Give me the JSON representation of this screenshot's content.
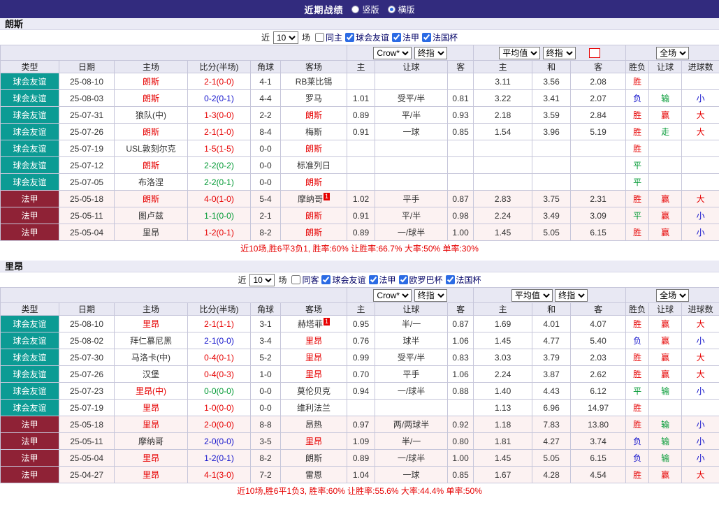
{
  "topbar": {
    "title": "近期战绩",
    "layout_options": [
      {
        "label": "竖版",
        "selected": false
      },
      {
        "label": "横版",
        "selected": true
      }
    ]
  },
  "tables": [
    {
      "team": "朗斯",
      "filter": {
        "prefix": "近",
        "count": "10",
        "suffix": "场",
        "checkboxes": [
          {
            "label": "同主",
            "checked": false
          },
          {
            "label": "球会友谊",
            "checked": true
          },
          {
            "label": "法甲",
            "checked": true
          },
          {
            "label": "法国杯",
            "checked": true
          }
        ]
      },
      "header": {
        "company": "Crow*",
        "company_type": "终指",
        "avg": "平均值",
        "avg_type": "终指",
        "scope": "全场",
        "cols": [
          "类型",
          "日期",
          "主场",
          "比分(半场)",
          "角球",
          "客场",
          "主",
          "让球",
          "客",
          "主",
          "和",
          "客",
          "胜负",
          "让球",
          "进球数"
        ]
      },
      "rows": [
        {
          "type": "球会友谊",
          "league": "friendly",
          "date": "25-08-10",
          "home": "朗斯",
          "home_focal": true,
          "home_badge": "",
          "score": "2-1(0-0)",
          "corner": "4-1",
          "away": "RB莱比锡",
          "away_focal": false,
          "away_badge": "",
          "odds_home": "",
          "handicap": "",
          "odds_away": "",
          "avg_home": "3.11",
          "avg_draw": "3.56",
          "avg_away": "2.08",
          "result": "胜",
          "handicap_result": "",
          "goals": ""
        },
        {
          "type": "球会友谊",
          "league": "friendly",
          "date": "25-08-03",
          "home": "朗斯",
          "home_focal": true,
          "home_badge": "",
          "score": "0-2(0-1)",
          "corner": "4-4",
          "away": "罗马",
          "away_focal": false,
          "away_badge": "",
          "odds_home": "1.01",
          "handicap": "受平/半",
          "odds_away": "0.81",
          "avg_home": "3.22",
          "avg_draw": "3.41",
          "avg_away": "2.07",
          "result": "负",
          "handicap_result": "输",
          "goals": "小"
        },
        {
          "type": "球会友谊",
          "league": "friendly",
          "date": "25-07-31",
          "home": "狼队(中)",
          "home_focal": false,
          "home_badge": "",
          "score": "1-3(0-0)",
          "corner": "2-2",
          "away": "朗斯",
          "away_focal": true,
          "away_badge": "",
          "odds_home": "0.89",
          "handicap": "平/半",
          "odds_away": "0.93",
          "avg_home": "2.18",
          "avg_draw": "3.59",
          "avg_away": "2.84",
          "result": "胜",
          "handicap_result": "赢",
          "goals": "大"
        },
        {
          "type": "球会友谊",
          "league": "friendly",
          "date": "25-07-26",
          "home": "朗斯",
          "home_focal": true,
          "home_badge": "",
          "score": "2-1(1-0)",
          "corner": "8-4",
          "away": "梅斯",
          "away_focal": false,
          "away_badge": "",
          "odds_home": "0.91",
          "handicap": "一球",
          "odds_away": "0.85",
          "avg_home": "1.54",
          "avg_draw": "3.96",
          "avg_away": "5.19",
          "result": "胜",
          "handicap_result": "走",
          "goals": "大"
        },
        {
          "type": "球会友谊",
          "league": "friendly",
          "date": "25-07-19",
          "home": "USL敦刻尔克",
          "home_focal": false,
          "home_badge": "",
          "score": "1-5(1-5)",
          "corner": "0-0",
          "away": "朗斯",
          "away_focal": true,
          "away_badge": "",
          "odds_home": "",
          "handicap": "",
          "odds_away": "",
          "avg_home": "",
          "avg_draw": "",
          "avg_away": "",
          "result": "胜",
          "handicap_result": "",
          "goals": ""
        },
        {
          "type": "球会友谊",
          "league": "friendly",
          "date": "25-07-12",
          "home": "朗斯",
          "home_focal": true,
          "home_badge": "",
          "score": "2-2(0-2)",
          "corner": "0-0",
          "away": "标准列日",
          "away_focal": false,
          "away_badge": "",
          "odds_home": "",
          "handicap": "",
          "odds_away": "",
          "avg_home": "",
          "avg_draw": "",
          "avg_away": "",
          "result": "平",
          "handicap_result": "",
          "goals": ""
        },
        {
          "type": "球会友谊",
          "league": "friendly",
          "date": "25-07-05",
          "home": "布洛涅",
          "home_focal": false,
          "home_badge": "",
          "score": "2-2(0-1)",
          "corner": "0-0",
          "away": "朗斯",
          "away_focal": true,
          "away_badge": "",
          "odds_home": "",
          "handicap": "",
          "odds_away": "",
          "avg_home": "",
          "avg_draw": "",
          "avg_away": "",
          "result": "平",
          "handicap_result": "",
          "goals": ""
        },
        {
          "type": "法甲",
          "league": "ligue1",
          "date": "25-05-18",
          "home": "朗斯",
          "home_focal": true,
          "home_badge": "",
          "score": "4-0(1-0)",
          "corner": "5-4",
          "away": "摩纳哥",
          "away_focal": false,
          "away_badge": "1",
          "odds_home": "1.02",
          "handicap": "平手",
          "odds_away": "0.87",
          "avg_home": "2.83",
          "avg_draw": "3.75",
          "avg_away": "2.31",
          "result": "胜",
          "handicap_result": "赢",
          "goals": "大"
        },
        {
          "type": "法甲",
          "league": "ligue1",
          "date": "25-05-11",
          "home": "图卢兹",
          "home_focal": false,
          "home_badge": "",
          "score": "1-1(0-0)",
          "corner": "2-1",
          "away": "朗斯",
          "away_focal": true,
          "away_badge": "",
          "odds_home": "0.91",
          "handicap": "平/半",
          "odds_away": "0.98",
          "avg_home": "2.24",
          "avg_draw": "3.49",
          "avg_away": "3.09",
          "result": "平",
          "handicap_result": "赢",
          "goals": "小"
        },
        {
          "type": "法甲",
          "league": "ligue1",
          "date": "25-05-04",
          "home": "里昂",
          "home_focal": false,
          "home_badge": "",
          "score": "1-2(0-1)",
          "corner": "8-2",
          "away": "朗斯",
          "away_focal": true,
          "away_badge": "",
          "odds_home": "0.89",
          "handicap": "一/球半",
          "odds_away": "1.00",
          "avg_home": "1.45",
          "avg_draw": "5.05",
          "avg_away": "6.15",
          "result": "胜",
          "handicap_result": "赢",
          "goals": "小"
        }
      ],
      "summary": "近10场,胜6平3负1, 胜率:60% 让胜率:66.7% 大率:50% 单率:30%"
    },
    {
      "team": "里昂",
      "filter": {
        "prefix": "近",
        "count": "10",
        "suffix": "场",
        "checkboxes": [
          {
            "label": "同客",
            "checked": false
          },
          {
            "label": "球会友谊",
            "checked": true
          },
          {
            "label": "法甲",
            "checked": true
          },
          {
            "label": "欧罗巴杯",
            "checked": true
          },
          {
            "label": "法国杯",
            "checked": true
          }
        ]
      },
      "header": {
        "company": "Crow*",
        "company_type": "终指",
        "avg": "平均值",
        "avg_type": "终指",
        "scope": "全场",
        "cols": [
          "类型",
          "日期",
          "主场",
          "比分(半场)",
          "角球",
          "客场",
          "主",
          "让球",
          "客",
          "主",
          "和",
          "客",
          "胜负",
          "让球",
          "进球数"
        ]
      },
      "rows": [
        {
          "type": "球会友谊",
          "league": "friendly",
          "date": "25-08-10",
          "home": "里昂",
          "home_focal": true,
          "home_badge": "",
          "score": "2-1(1-1)",
          "corner": "3-1",
          "away": "赫塔菲",
          "away_focal": false,
          "away_badge": "1",
          "odds_home": "0.95",
          "handicap": "半/一",
          "odds_away": "0.87",
          "avg_home": "1.69",
          "avg_draw": "4.01",
          "avg_away": "4.07",
          "result": "胜",
          "handicap_result": "赢",
          "goals": "大"
        },
        {
          "type": "球会友谊",
          "league": "friendly",
          "date": "25-08-02",
          "home": "拜仁慕尼黑",
          "home_focal": false,
          "home_badge": "",
          "score": "2-1(0-0)",
          "corner": "3-4",
          "away": "里昂",
          "away_focal": true,
          "away_badge": "",
          "odds_home": "0.76",
          "handicap": "球半",
          "odds_away": "1.06",
          "avg_home": "1.45",
          "avg_draw": "4.77",
          "avg_away": "5.40",
          "result": "负",
          "handicap_result": "赢",
          "goals": "小"
        },
        {
          "type": "球会友谊",
          "league": "friendly",
          "date": "25-07-30",
          "home": "马洛卡(中)",
          "home_focal": false,
          "home_badge": "",
          "score": "0-4(0-1)",
          "corner": "5-2",
          "away": "里昂",
          "away_focal": true,
          "away_badge": "",
          "odds_home": "0.99",
          "handicap": "受平/半",
          "odds_away": "0.83",
          "avg_home": "3.03",
          "avg_draw": "3.79",
          "avg_away": "2.03",
          "result": "胜",
          "handicap_result": "赢",
          "goals": "大"
        },
        {
          "type": "球会友谊",
          "league": "friendly",
          "date": "25-07-26",
          "home": "汉堡",
          "home_focal": false,
          "home_badge": "",
          "score": "0-4(0-3)",
          "corner": "1-0",
          "away": "里昂",
          "away_focal": true,
          "away_badge": "",
          "odds_home": "0.70",
          "handicap": "平手",
          "odds_away": "1.06",
          "avg_home": "2.24",
          "avg_draw": "3.87",
          "avg_away": "2.62",
          "result": "胜",
          "handicap_result": "赢",
          "goals": "大"
        },
        {
          "type": "球会友谊",
          "league": "friendly",
          "date": "25-07-23",
          "home": "里昂(中)",
          "home_focal": true,
          "home_badge": "",
          "score": "0-0(0-0)",
          "corner": "0-0",
          "away": "莫伦贝克",
          "away_focal": false,
          "away_badge": "",
          "odds_home": "0.94",
          "handicap": "一/球半",
          "odds_away": "0.88",
          "avg_home": "1.40",
          "avg_draw": "4.43",
          "avg_away": "6.12",
          "result": "平",
          "handicap_result": "输",
          "goals": "小"
        },
        {
          "type": "球会友谊",
          "league": "friendly",
          "date": "25-07-19",
          "home": "里昂",
          "home_focal": true,
          "home_badge": "",
          "score": "1-0(0-0)",
          "corner": "0-0",
          "away": "维利法兰",
          "away_focal": false,
          "away_badge": "",
          "odds_home": "",
          "handicap": "",
          "odds_away": "",
          "avg_home": "1.13",
          "avg_draw": "6.96",
          "avg_away": "14.97",
          "result": "胜",
          "handicap_result": "",
          "goals": ""
        },
        {
          "type": "法甲",
          "league": "ligue1",
          "date": "25-05-18",
          "home": "里昂",
          "home_focal": true,
          "home_badge": "",
          "score": "2-0(0-0)",
          "corner": "8-8",
          "away": "昂热",
          "away_focal": false,
          "away_badge": "",
          "odds_home": "0.97",
          "handicap": "两/两球半",
          "odds_away": "0.92",
          "avg_home": "1.18",
          "avg_draw": "7.83",
          "avg_away": "13.80",
          "result": "胜",
          "handicap_result": "输",
          "goals": "小"
        },
        {
          "type": "法甲",
          "league": "ligue1",
          "date": "25-05-11",
          "home": "摩纳哥",
          "home_focal": false,
          "home_badge": "",
          "score": "2-0(0-0)",
          "corner": "3-5",
          "away": "里昂",
          "away_focal": true,
          "away_badge": "",
          "odds_home": "1.09",
          "handicap": "半/一",
          "odds_away": "0.80",
          "avg_home": "1.81",
          "avg_draw": "4.27",
          "avg_away": "3.74",
          "result": "负",
          "handicap_result": "输",
          "goals": "小"
        },
        {
          "type": "法甲",
          "league": "ligue1",
          "date": "25-05-04",
          "home": "里昂",
          "home_focal": true,
          "home_badge": "",
          "score": "1-2(0-1)",
          "corner": "8-2",
          "away": "朗斯",
          "away_focal": false,
          "away_badge": "",
          "odds_home": "0.89",
          "handicap": "一/球半",
          "odds_away": "1.00",
          "avg_home": "1.45",
          "avg_draw": "5.05",
          "avg_away": "6.15",
          "result": "负",
          "handicap_result": "输",
          "goals": "小"
        },
        {
          "type": "法甲",
          "league": "ligue1",
          "date": "25-04-27",
          "home": "里昂",
          "home_focal": true,
          "home_badge": "",
          "score": "4-1(3-0)",
          "corner": "7-2",
          "away": "雷恩",
          "away_focal": false,
          "away_badge": "",
          "odds_home": "1.04",
          "handicap": "一球",
          "odds_away": "0.85",
          "avg_home": "1.67",
          "avg_draw": "4.28",
          "avg_away": "4.54",
          "result": "胜",
          "handicap_result": "赢",
          "goals": "大"
        }
      ],
      "summary": "近10场,胜6平1负3, 胜率:60% 让胜率:55.6% 大率:44.4% 单率:50%"
    }
  ]
}
